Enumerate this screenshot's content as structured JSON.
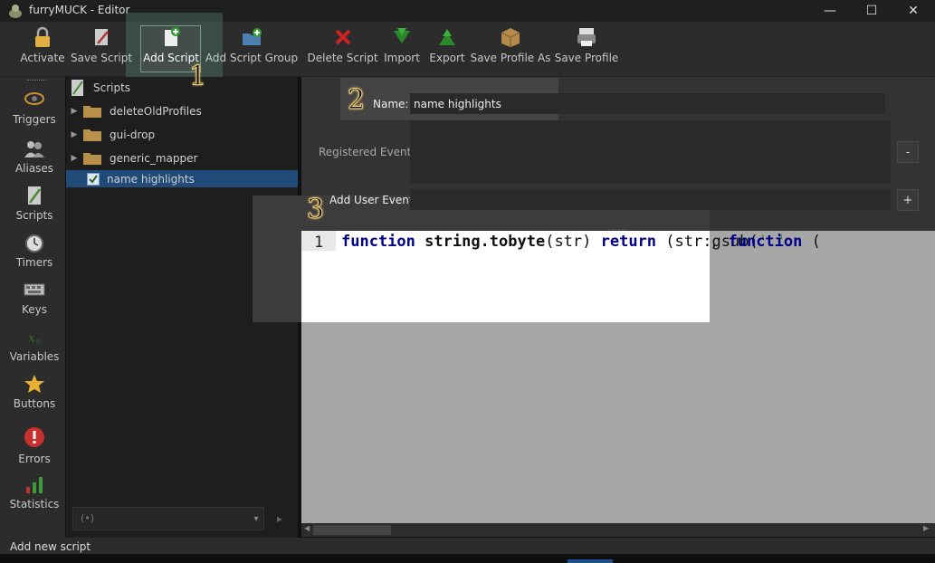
{
  "window": {
    "title": "furryMUCK - Editor",
    "minimize_glyph": "—",
    "maximize_glyph": "☐",
    "close_glyph": "✕"
  },
  "toolbar": {
    "buttons": [
      {
        "label": "Activate",
        "icon": "lock-icon"
      },
      {
        "label": "Save Script",
        "icon": "save-script-icon"
      },
      {
        "label": "Add Script",
        "icon": "add-script-icon"
      },
      {
        "label": "Add Script Group",
        "icon": "add-group-icon"
      },
      {
        "label": "Delete Script",
        "icon": "delete-icon"
      },
      {
        "label": "Import",
        "icon": "import-icon"
      },
      {
        "label": "Export",
        "icon": "export-icon"
      },
      {
        "label": "Save Profile As",
        "icon": "save-profile-as-icon"
      },
      {
        "label": "Save Profile",
        "icon": "save-profile-icon"
      }
    ]
  },
  "sidebar": {
    "items": [
      {
        "label": "Triggers"
      },
      {
        "label": "Aliases"
      },
      {
        "label": "Scripts"
      },
      {
        "label": "Timers"
      },
      {
        "label": "Keys"
      },
      {
        "label": "Variables"
      },
      {
        "label": "Buttons"
      },
      {
        "label": "Errors"
      },
      {
        "label": "Statistics"
      }
    ]
  },
  "tree": {
    "root": "Scripts",
    "items": [
      {
        "label": "deleteOldProfiles",
        "type": "folder"
      },
      {
        "label": "gui-drop",
        "type": "folder"
      },
      {
        "label": "generic_mapper",
        "type": "folder"
      },
      {
        "label": "name highlights",
        "type": "script",
        "checked": true,
        "selected": true
      }
    ],
    "search_icon": "(•)",
    "dropdown_glyph": "▾",
    "go_glyph": "▸"
  },
  "form": {
    "name_label": "Name:",
    "name_value": "name highlights",
    "registered_events_label": "Registered Events:",
    "remove_button": "-",
    "add_user_event_label": "Add User Event:",
    "add_button": "+"
  },
  "editor": {
    "line_number": "1",
    "code_tokens": [
      {
        "t": "function",
        "c": "kw"
      },
      {
        "t": " ",
        "c": ""
      },
      {
        "t": "string.tobyte",
        "c": "fn"
      },
      {
        "t": "(str) ",
        "c": ""
      },
      {
        "t": "return",
        "c": "kw"
      },
      {
        "t": " (str:gsub(",
        "c": ""
      },
      {
        "t": "'.'",
        "c": "str"
      },
      {
        "t": ", ",
        "c": ""
      },
      {
        "t": "function",
        "c": "kw"
      },
      {
        "t": " (",
        "c": ""
      }
    ],
    "splitter_glyph": "·····"
  },
  "status": {
    "text": "Add new script"
  },
  "annotations": {
    "one": "1",
    "two": "2",
    "three": "3"
  }
}
